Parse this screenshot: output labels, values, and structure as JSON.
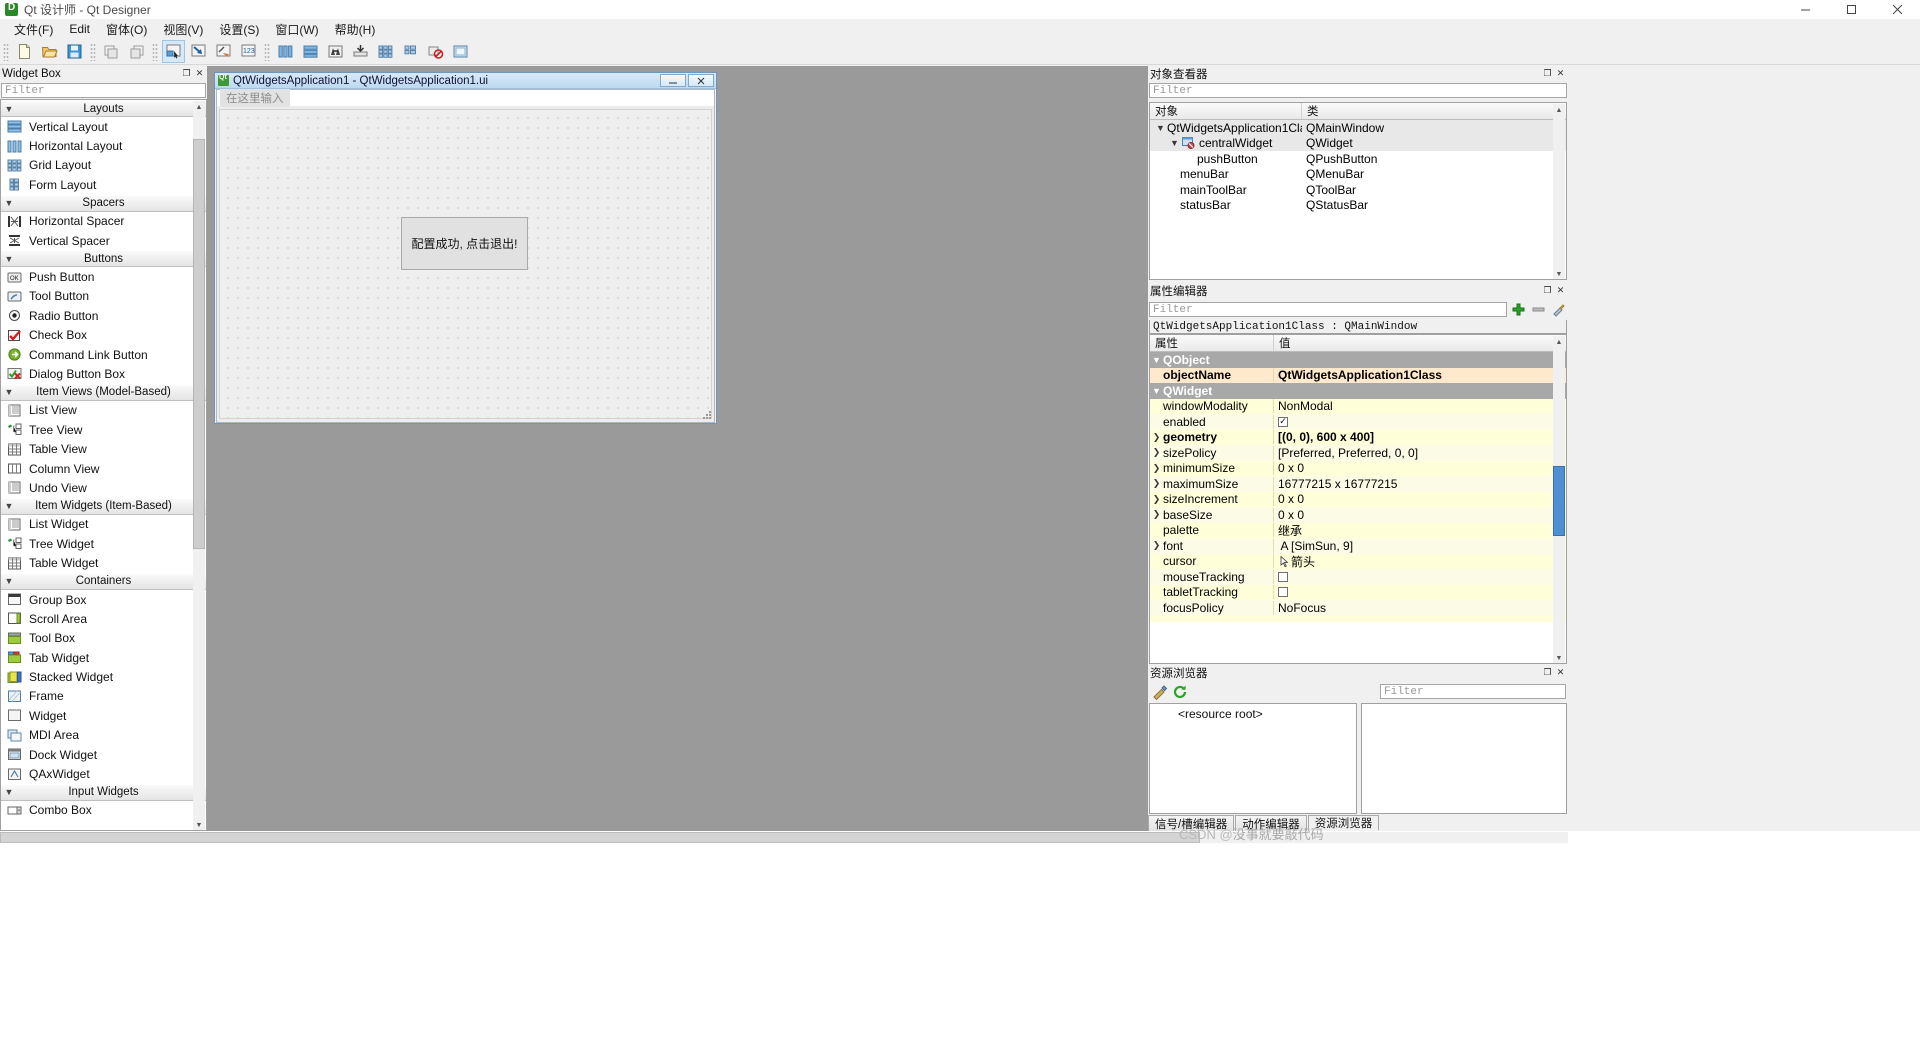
{
  "window": {
    "title": "Qt 设计师 - Qt Designer",
    "app_icon": "qt-designer-icon",
    "minimize": "—",
    "maximize": "❐",
    "close": "✕"
  },
  "menubar": {
    "items": [
      {
        "label": "文件(F)",
        "name": "menu-file"
      },
      {
        "label": "Edit",
        "name": "menu-edit"
      },
      {
        "label": "窗体(O)",
        "name": "menu-form"
      },
      {
        "label": "视图(V)",
        "name": "menu-view"
      },
      {
        "label": "设置(S)",
        "name": "menu-settings"
      },
      {
        "label": "窗口(W)",
        "name": "menu-window"
      },
      {
        "label": "帮助(H)",
        "name": "menu-help"
      }
    ]
  },
  "toolbar": {
    "buttons": [
      {
        "name": "new-form-icon",
        "tip": "新建"
      },
      {
        "name": "open-form-icon",
        "tip": "打开"
      },
      {
        "name": "save-form-icon",
        "tip": "保存"
      },
      {
        "name": "undo-icon",
        "tip": "撤销"
      },
      {
        "name": "redo-icon",
        "tip": "重做"
      },
      {
        "name": "edit-widgets-icon",
        "tip": "编辑控件",
        "active": true
      },
      {
        "name": "edit-signals-slots-icon",
        "tip": "编辑信号/槽"
      },
      {
        "name": "edit-buddies-icon",
        "tip": "编辑伙伴"
      },
      {
        "name": "edit-tab-order-icon",
        "tip": "编辑Tab顺序"
      },
      {
        "name": "layout-horizontal-icon",
        "tip": "水平布局"
      },
      {
        "name": "layout-vertical-icon",
        "tip": "垂直布局"
      },
      {
        "name": "layout-splitter-horizontal-icon",
        "tip": "水平分裂器布局"
      },
      {
        "name": "layout-splitter-vertical-icon",
        "tip": "垂直分裂器布局"
      },
      {
        "name": "layout-grid-icon",
        "tip": "栅格布局"
      },
      {
        "name": "layout-form-icon",
        "tip": "表单布局"
      },
      {
        "name": "break-layout-icon",
        "tip": "打破布局"
      },
      {
        "name": "adjust-size-icon",
        "tip": "调整大小"
      }
    ]
  },
  "widget_box": {
    "title": "Widget Box",
    "float_btn": "❐",
    "close_btn": "✕",
    "filter_placeholder": "Filter",
    "categories": [
      {
        "name": "Layouts",
        "label": "Layouts",
        "expanded": true,
        "items": [
          {
            "label": "Vertical Layout",
            "icon": "layout-vertical-icon"
          },
          {
            "label": "Horizontal Layout",
            "icon": "layout-horizontal-icon"
          },
          {
            "label": "Grid Layout",
            "icon": "layout-grid-icon"
          },
          {
            "label": "Form Layout",
            "icon": "layout-form-icon"
          }
        ]
      },
      {
        "name": "Spacers",
        "label": "Spacers",
        "expanded": true,
        "items": [
          {
            "label": "Horizontal Spacer",
            "icon": "spacer-horizontal-icon"
          },
          {
            "label": "Vertical Spacer",
            "icon": "spacer-vertical-icon"
          }
        ]
      },
      {
        "name": "Buttons",
        "label": "Buttons",
        "expanded": true,
        "items": [
          {
            "label": "Push Button",
            "icon": "push-button-icon"
          },
          {
            "label": "Tool Button",
            "icon": "tool-button-icon"
          },
          {
            "label": "Radio Button",
            "icon": "radio-button-icon"
          },
          {
            "label": "Check Box",
            "icon": "check-box-icon"
          },
          {
            "label": "Command Link Button",
            "icon": "command-link-button-icon"
          },
          {
            "label": "Dialog Button Box",
            "icon": "dialog-button-box-icon"
          }
        ]
      },
      {
        "name": "Item Views (Model-Based)",
        "label": "Item Views (Model-Based)",
        "expanded": true,
        "items": [
          {
            "label": "List View",
            "icon": "list-view-icon"
          },
          {
            "label": "Tree View",
            "icon": "tree-view-icon"
          },
          {
            "label": "Table View",
            "icon": "table-view-icon"
          },
          {
            "label": "Column View",
            "icon": "column-view-icon"
          },
          {
            "label": "Undo View",
            "icon": "undo-view-icon"
          }
        ]
      },
      {
        "name": "Item Widgets (Item-Based)",
        "label": "Item Widgets (Item-Based)",
        "expanded": true,
        "items": [
          {
            "label": "List Widget",
            "icon": "list-widget-icon"
          },
          {
            "label": "Tree Widget",
            "icon": "tree-widget-icon"
          },
          {
            "label": "Table Widget",
            "icon": "table-widget-icon"
          }
        ]
      },
      {
        "name": "Containers",
        "label": "Containers",
        "expanded": true,
        "items": [
          {
            "label": "Group Box",
            "icon": "group-box-icon"
          },
          {
            "label": "Scroll Area",
            "icon": "scroll-area-icon"
          },
          {
            "label": "Tool Box",
            "icon": "tool-box-icon"
          },
          {
            "label": "Tab Widget",
            "icon": "tab-widget-icon"
          },
          {
            "label": "Stacked Widget",
            "icon": "stacked-widget-icon"
          },
          {
            "label": "Frame",
            "icon": "frame-icon"
          },
          {
            "label": "Widget",
            "icon": "widget-icon"
          },
          {
            "label": "MDI Area",
            "icon": "mdi-area-icon"
          },
          {
            "label": "Dock Widget",
            "icon": "dock-widget-icon"
          },
          {
            "label": "QAxWidget",
            "icon": "qax-widget-icon"
          }
        ]
      },
      {
        "name": "Input Widgets",
        "label": "Input Widgets",
        "expanded": true,
        "items": [
          {
            "label": "Combo Box",
            "icon": "combo-box-icon"
          }
        ]
      }
    ]
  },
  "form_window": {
    "title": "QtWidgetsApplication1 - QtWidgetsApplication1.ui",
    "icon": "qt-icon",
    "minimize": "—",
    "close": "✕",
    "menu_placeholder": "在这里输入",
    "push_button_text": "配置成功, 点击退出!"
  },
  "object_inspector": {
    "title": "对象查看器",
    "float_btn": "❐",
    "close_btn": "✕",
    "filter_placeholder": "Filter",
    "columns": [
      "对象",
      "类"
    ],
    "rows": [
      {
        "indent": 0,
        "twisty": "▼",
        "icon": "qmainwindow-icon",
        "object": "QtWidgetsApplication1Class",
        "class": "QMainWindow",
        "selected": true
      },
      {
        "indent": 1,
        "twisty": "▼",
        "icon": "qwidget-icon",
        "object": "centralWidget",
        "class": "QWidget",
        "selected": true
      },
      {
        "indent": 2,
        "twisty": "",
        "icon": "",
        "object": "pushButton",
        "class": "QPushButton",
        "selected": false
      },
      {
        "indent": 1,
        "twisty": "",
        "icon": "",
        "object": "menuBar",
        "class": "QMenuBar",
        "selected": false
      },
      {
        "indent": 1,
        "twisty": "",
        "icon": "",
        "object": "mainToolBar",
        "class": "QToolBar",
        "selected": false
      },
      {
        "indent": 1,
        "twisty": "",
        "icon": "",
        "object": "statusBar",
        "class": "QStatusBar",
        "selected": false
      }
    ]
  },
  "property_editor": {
    "title": "属性编辑器",
    "float_btn": "❐",
    "close_btn": "✕",
    "filter_placeholder": "Filter",
    "object_line": "QtWidgetsApplication1Class : QMainWindow",
    "toolbar_icons": [
      "add-property-icon",
      "remove-property-icon",
      "configure-icon"
    ],
    "columns": [
      "属性",
      "值"
    ],
    "rows": [
      {
        "type": "group",
        "twisty": "▼",
        "key": "QObject",
        "value": ""
      },
      {
        "type": "prop",
        "twisty": "",
        "key": "objectName",
        "value": "QtWidgetsApplication1Class",
        "highlight": "peach",
        "bold": true
      },
      {
        "type": "group",
        "twisty": "▼",
        "key": "QWidget",
        "value": ""
      },
      {
        "type": "prop",
        "twisty": "",
        "key": "windowModality",
        "value": "NonModal"
      },
      {
        "type": "prop",
        "twisty": "",
        "key": "enabled",
        "value": "",
        "checkbox": true,
        "checked": true
      },
      {
        "type": "prop",
        "twisty": "▶",
        "key": "geometry",
        "value": "[(0, 0), 600 x 400]",
        "bold": true
      },
      {
        "type": "prop",
        "twisty": "▶",
        "key": "sizePolicy",
        "value": "[Preferred, Preferred, 0, 0]"
      },
      {
        "type": "prop",
        "twisty": "▶",
        "key": "minimumSize",
        "value": "0 x 0"
      },
      {
        "type": "prop",
        "twisty": "▶",
        "key": "maximumSize",
        "value": "16777215 x 16777215"
      },
      {
        "type": "prop",
        "twisty": "▶",
        "key": "sizeIncrement",
        "value": "0 x 0"
      },
      {
        "type": "prop",
        "twisty": "▶",
        "key": "baseSize",
        "value": "0 x 0"
      },
      {
        "type": "prop",
        "twisty": "",
        "key": "palette",
        "value": "继承"
      },
      {
        "type": "prop",
        "twisty": "▶",
        "key": "font",
        "value": "[SimSun, 9]",
        "icon": "font-icon"
      },
      {
        "type": "prop",
        "twisty": "",
        "key": "cursor",
        "value": "箭头",
        "icon": "cursor-icon"
      },
      {
        "type": "prop",
        "twisty": "",
        "key": "mouseTracking",
        "value": "",
        "checkbox": true,
        "checked": false
      },
      {
        "type": "prop",
        "twisty": "",
        "key": "tabletTracking",
        "value": "",
        "checkbox": true,
        "checked": false
      },
      {
        "type": "prop",
        "twisty": "",
        "key": "focusPolicy",
        "value": "NoFocus"
      }
    ]
  },
  "resource_browser": {
    "title": "资源浏览器",
    "float_btn": "❐",
    "close_btn": "✕",
    "edit_icon": "pencil-icon",
    "reload_icon": "reload-icon",
    "filter_placeholder": "Filter",
    "root_item": "<resource root>",
    "tabs": [
      {
        "label": "信号/槽编辑器",
        "active": false
      },
      {
        "label": "动作编辑器",
        "active": false
      },
      {
        "label": "资源浏览器",
        "active": true
      }
    ]
  },
  "watermark": {
    "prefix": "CSDN @",
    "text": "没事就要敲代码"
  },
  "colors": {
    "accent": "#bcd9f0",
    "panel_bg": "#f0f0f0",
    "mdi_bg": "#9a9a9a",
    "prop_yellow": "#feffd9",
    "prop_peach": "#ffe9cc",
    "group_gray": "#a8a8a8"
  }
}
